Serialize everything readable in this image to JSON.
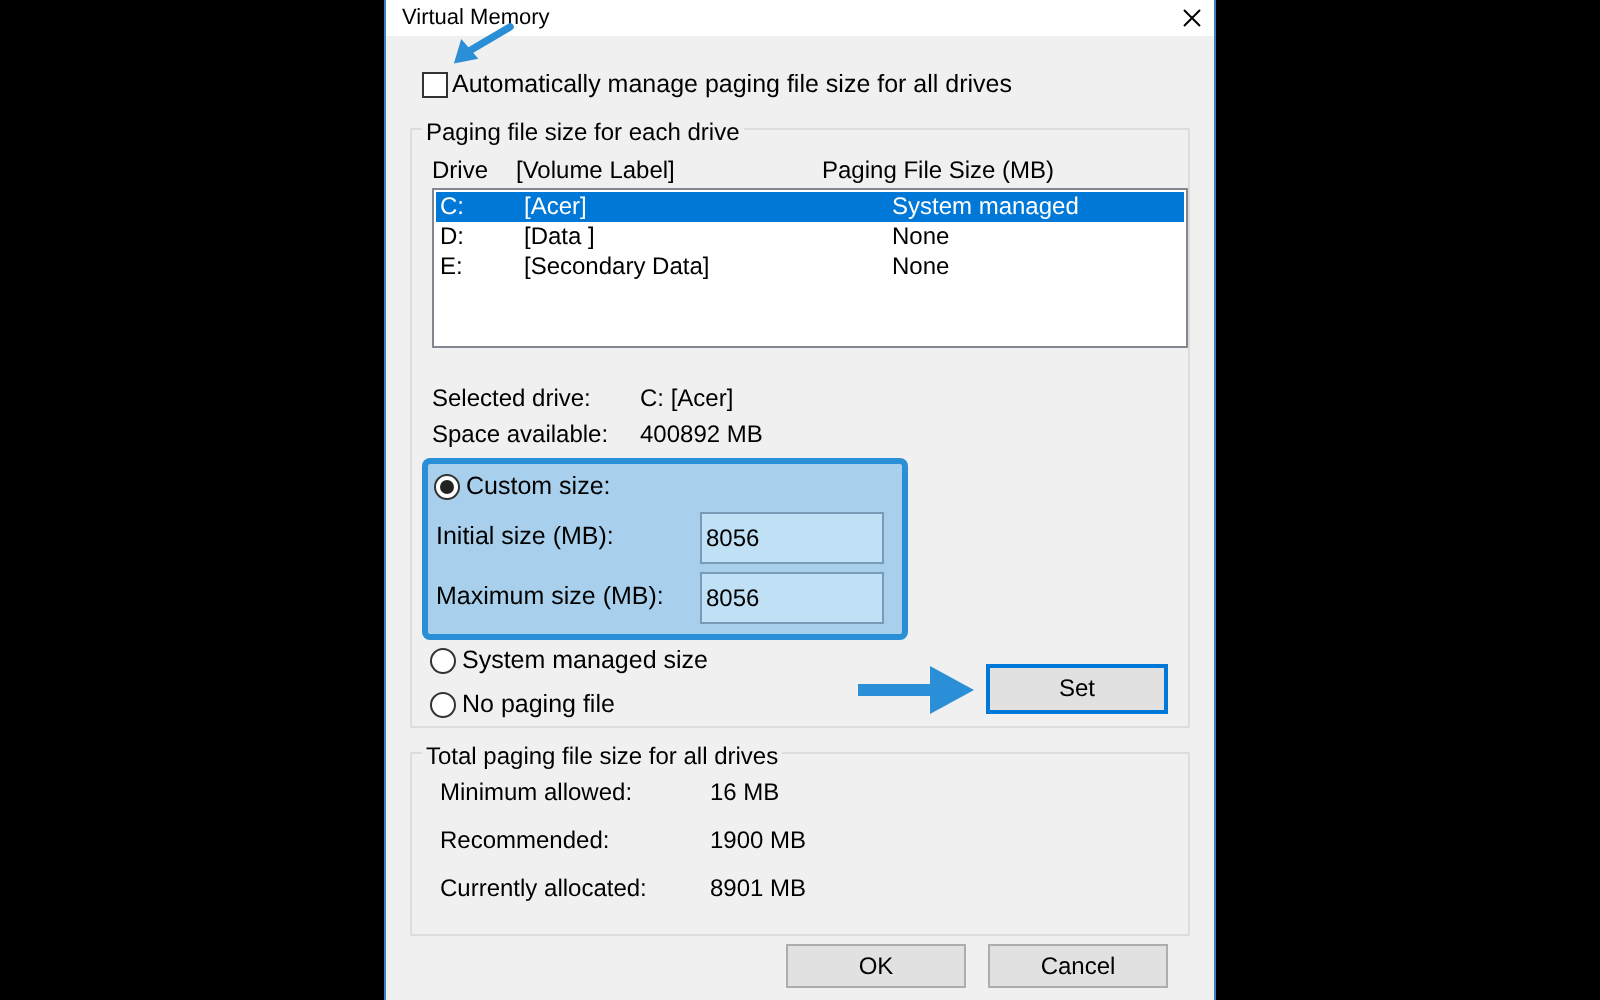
{
  "window": {
    "title": "Virtual Memory"
  },
  "auto_manage": {
    "label": "Automatically manage paging file size for all drives",
    "checked": false
  },
  "drive_group": {
    "title": "Paging file size for each drive",
    "columns": [
      "Drive",
      "[Volume Label]",
      "Paging File Size (MB)"
    ],
    "drives": [
      {
        "drive": "C:",
        "label": "[Acer]",
        "size": "System managed",
        "selected": true
      },
      {
        "drive": "D:",
        "label": "[Data ]",
        "size": "None",
        "selected": false
      },
      {
        "drive": "E:",
        "label": "[Secondary Data]",
        "size": "None",
        "selected": false
      }
    ],
    "selected_drive": {
      "label": "Selected drive:",
      "value": "C:  [Acer]"
    },
    "space_available": {
      "label": "Space available:",
      "value": "400892 MB"
    },
    "options": [
      {
        "kind": "custom",
        "label": "Custom size:",
        "selected": true,
        "fields": [
          {
            "label": "Initial size (MB):",
            "value": "8056"
          },
          {
            "label": "Maximum size (MB):",
            "value": "8056"
          }
        ]
      },
      {
        "kind": "plain",
        "label": "System managed size",
        "selected": false
      },
      {
        "kind": "plain",
        "label": "No paging file",
        "selected": false
      }
    ],
    "set_button": "Set"
  },
  "totals": {
    "title": "Total paging file size for all drives",
    "rows": [
      {
        "label": "Minimum allowed:",
        "value": "16 MB"
      },
      {
        "label": "Recommended:",
        "value": "1900 MB"
      },
      {
        "label": "Currently allocated:",
        "value": "8901 MB"
      }
    ]
  },
  "buttons": [
    "OK",
    "Cancel"
  ]
}
